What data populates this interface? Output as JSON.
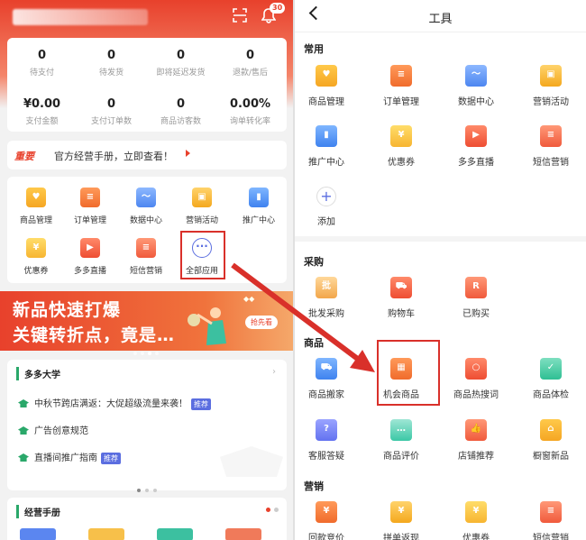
{
  "left": {
    "notification_count": "30",
    "stats_row1": [
      {
        "value": "0",
        "label": "待支付"
      },
      {
        "value": "0",
        "label": "待发货"
      },
      {
        "value": "0",
        "label": "即将延迟发货"
      },
      {
        "value": "0",
        "label": "退款/售后"
      }
    ],
    "stats_row2": [
      {
        "value": "¥0.00",
        "label": "支付金额"
      },
      {
        "value": "0",
        "label": "支付订单数"
      },
      {
        "value": "0",
        "label": "商品访客数"
      },
      {
        "value": "0.00%",
        "label": "询单转化率"
      }
    ],
    "notice": {
      "tag": "重要",
      "text": "官方经营手册，立即查看！"
    },
    "apps_row1": [
      {
        "label": "商品管理",
        "icon": "bag-icon"
      },
      {
        "label": "订单管理",
        "icon": "clipboard-icon"
      },
      {
        "label": "数据中心",
        "icon": "chart-icon"
      },
      {
        "label": "营销活动",
        "icon": "gift-icon"
      },
      {
        "label": "推广中心",
        "icon": "bar-chart-icon"
      }
    ],
    "apps_row2": [
      {
        "label": "优惠券",
        "icon": "coupon-icon"
      },
      {
        "label": "多多直播",
        "icon": "video-icon"
      },
      {
        "label": "短信营销",
        "icon": "message-icon"
      },
      {
        "label": "全部应用",
        "icon": "more-icon"
      }
    ],
    "banner": {
      "line1": "新品快速打爆",
      "line2": "关键转折点，竟是…",
      "button": "抢先看"
    },
    "university": {
      "title": "多多大学",
      "items": [
        {
          "text": "中秋节跨店满返：大促超级流量来袭！",
          "badge": "推荐"
        },
        {
          "text": "广告创意规范",
          "badge": ""
        },
        {
          "text": "直播间推广指南",
          "badge": "推荐"
        }
      ]
    },
    "manual": {
      "title": "经营手册"
    }
  },
  "right": {
    "title": "工具",
    "sections": [
      {
        "name": "常用",
        "items": [
          {
            "label": "商品管理",
            "icon": "bag-icon"
          },
          {
            "label": "订单管理",
            "icon": "clipboard-icon"
          },
          {
            "label": "数据中心",
            "icon": "chart-icon"
          },
          {
            "label": "营销活动",
            "icon": "gift-icon"
          },
          {
            "label": "推广中心",
            "icon": "bar-chart-icon"
          },
          {
            "label": "优惠券",
            "icon": "coupon-icon"
          },
          {
            "label": "多多直播",
            "icon": "video-icon"
          },
          {
            "label": "短信营销",
            "icon": "message-icon"
          },
          {
            "label": "添加",
            "icon": "plus-icon"
          }
        ]
      },
      {
        "name": "采购",
        "items": [
          {
            "label": "批发采购",
            "icon": "wholesale-icon"
          },
          {
            "label": "购物车",
            "icon": "cart-icon"
          },
          {
            "label": "已购买",
            "icon": "purchased-icon"
          }
        ]
      },
      {
        "name": "商品",
        "items": [
          {
            "label": "商品搬家",
            "icon": "truck-icon"
          },
          {
            "label": "机会商品",
            "icon": "opportunity-icon"
          },
          {
            "label": "商品热搜词",
            "icon": "search-icon"
          },
          {
            "label": "商品体检",
            "icon": "checkup-icon"
          },
          {
            "label": "客服答疑",
            "icon": "faq-icon"
          },
          {
            "label": "商品评价",
            "icon": "review-icon"
          },
          {
            "label": "店铺推荐",
            "icon": "thumbs-up-icon"
          },
          {
            "label": "橱窗新品",
            "icon": "showcase-icon"
          }
        ]
      },
      {
        "name": "营销",
        "items": [
          {
            "label": "回款竞价",
            "icon": "bid-icon"
          },
          {
            "label": "拼单返现",
            "icon": "cashback-icon"
          },
          {
            "label": "优惠券",
            "icon": "coupon-icon"
          },
          {
            "label": "短信营销",
            "icon": "message-icon"
          }
        ]
      }
    ]
  }
}
